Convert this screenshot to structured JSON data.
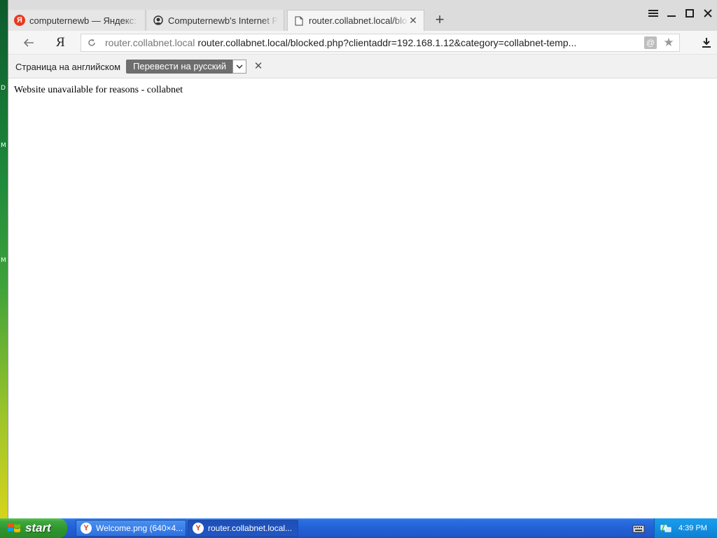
{
  "desktop": {
    "labels": [
      "D",
      "M",
      "M"
    ]
  },
  "tabs": [
    {
      "title": "computernewb — Яндекс: н",
      "icon": "yandex-icon",
      "active": false
    },
    {
      "title": "Computernewb's Internet Pu",
      "icon": "site-favicon-icon",
      "active": false
    },
    {
      "title": "router.collabnet.local/bloc",
      "icon": "page-icon",
      "active": true
    }
  ],
  "toolbar": {
    "logo": "Я",
    "address_host": "router.collabnet.local",
    "address_url": "router.collabnet.local/blocked.php?clientaddr=192.168.1.12&category=collabnet-temp..."
  },
  "translate": {
    "message": "Страница на английском",
    "button": "Перевести на русский"
  },
  "page": {
    "text": "Website unavailable for reasons - collabnet"
  },
  "taskbar": {
    "start_label": "start",
    "items": [
      {
        "title": "Welcome.png (640×4...",
        "active": false
      },
      {
        "title": "router.collabnet.local...",
        "active": true
      }
    ],
    "time": "4:39 PM"
  },
  "colors": {
    "yandex_red": "#e8381e",
    "taskbar_blue": "#2460d6",
    "start_green": "#2f952f",
    "tray_blue": "#148fe0"
  }
}
